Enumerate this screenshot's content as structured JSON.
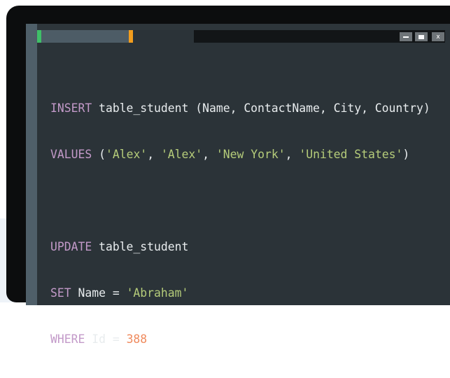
{
  "window": {
    "minimize_label": "",
    "maximize_label": "",
    "close_label": "x"
  },
  "code": {
    "line1": {
      "keyword": "INSERT",
      "rest": " table_student (Name, ContactName, City, Country)"
    },
    "line2": {
      "keyword": "VALUES",
      "open": " (",
      "v1": "'Alex'",
      "sep1": ", ",
      "v2": "'Alex'",
      "sep2": ", ",
      "v3": "'New York'",
      "sep3": ", ",
      "v4": "'United States'",
      "close": ")"
    },
    "line3": {
      "keyword": "UPDATE",
      "rest": " table_student"
    },
    "line4": {
      "keyword": "SET",
      "rest": " Name = ",
      "value": "'Abraham'"
    },
    "line5": {
      "keyword": "WHERE",
      "rest": " Id = ",
      "value": "388"
    }
  },
  "colors": {
    "keyword": "#c39ac9",
    "string": "#b5cc7a",
    "number": "#f08a5d",
    "tab_left_accent": "#3fbf68",
    "tab_right_accent": "#f29d1d",
    "editor_background": "#2b3338"
  }
}
